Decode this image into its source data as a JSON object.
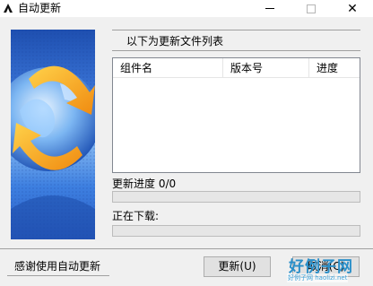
{
  "window": {
    "title": "自动更新",
    "icon": "app-logo-icon"
  },
  "header": {
    "title": "以下为更新文件列表"
  },
  "list": {
    "columns": [
      "组件名",
      "版本号",
      "进度"
    ],
    "rows": []
  },
  "progress": {
    "update_label": "更新进度 0/0",
    "update_fraction": 0,
    "downloading_label": "正在下载:",
    "downloading_fraction": 0
  },
  "footer": {
    "thanks_text": "感谢使用自动更新",
    "update_button": "更新(U)",
    "cancel_button": "取消(C)"
  },
  "watermark": {
    "big": "好例子网",
    "small": "好例子网 haolizi.net"
  },
  "colors": {
    "window_bg": "#f0f0f0",
    "progress_fill": "#06b025",
    "watermark": "#2a8fc9"
  }
}
